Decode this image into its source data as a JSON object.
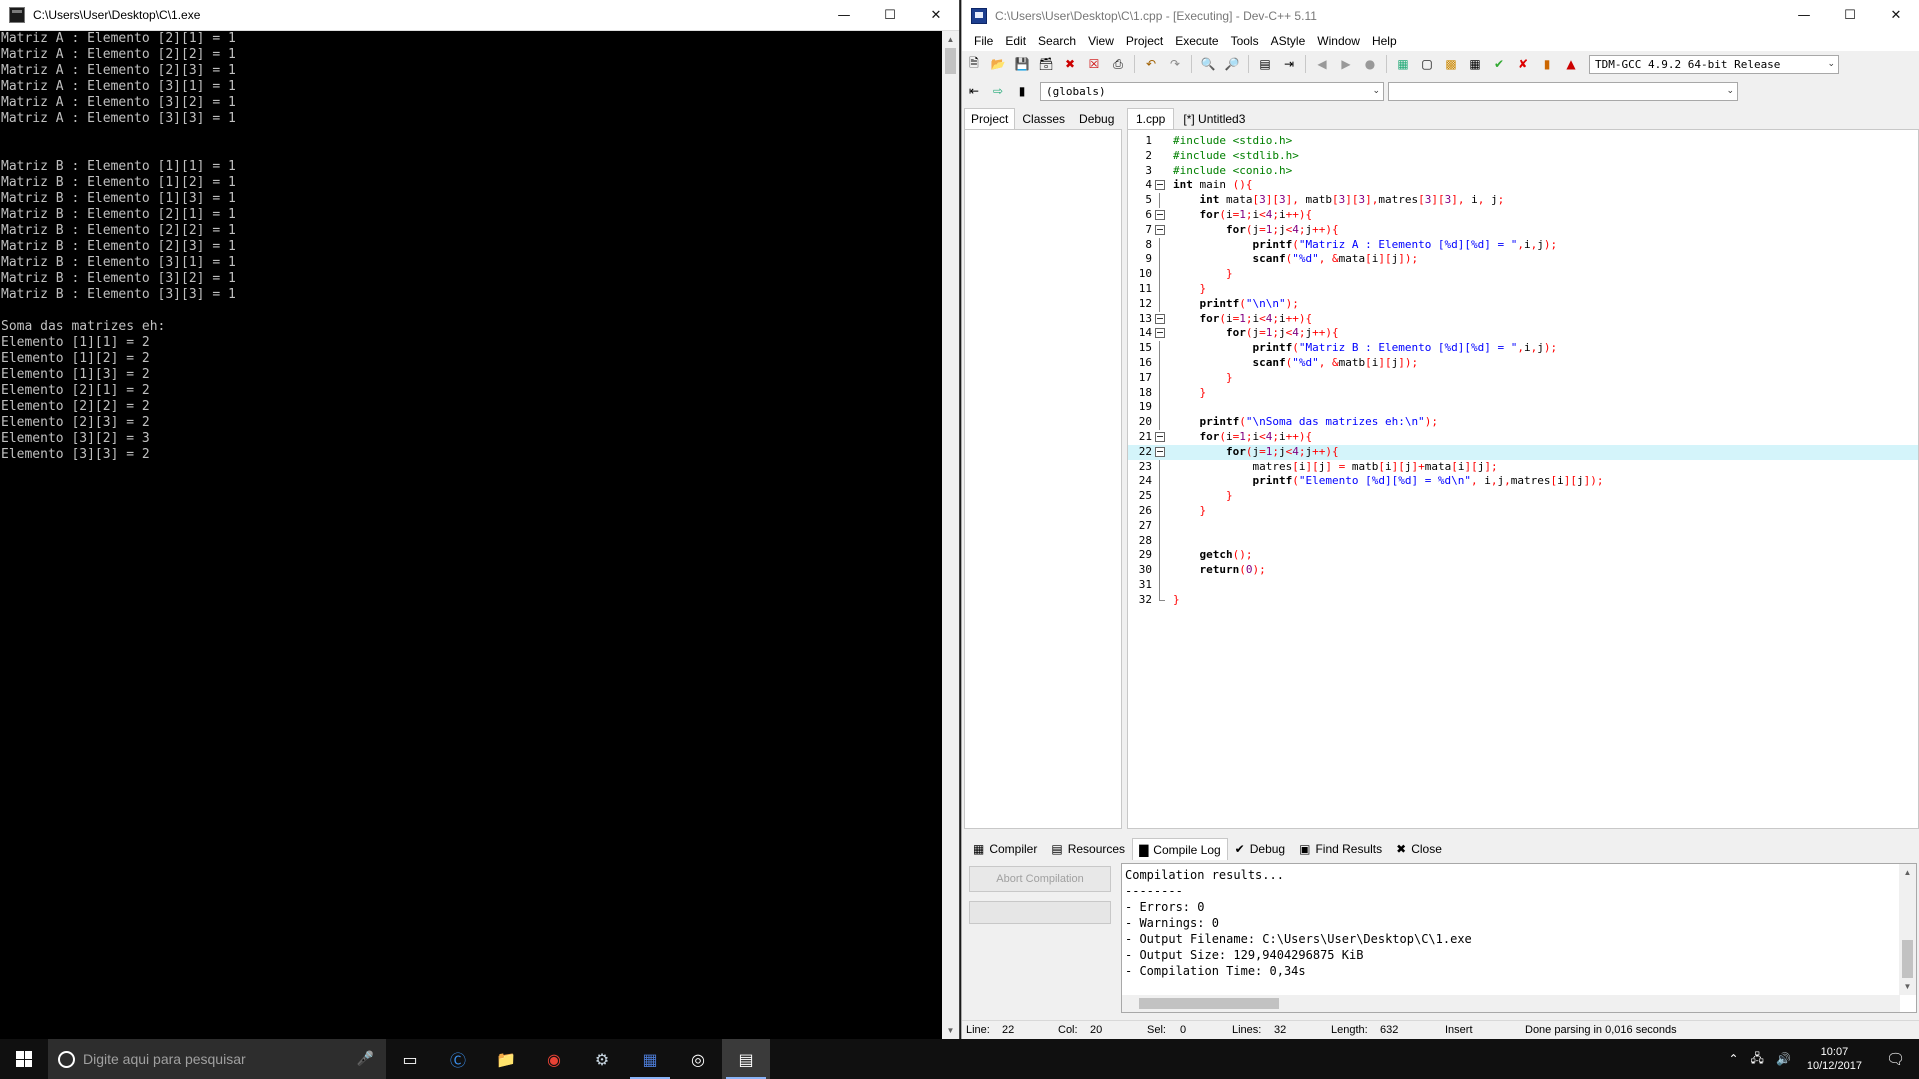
{
  "console_window": {
    "title": "C:\\Users\\User\\Desktop\\C\\1.exe",
    "output_lines": [
      "Matriz A : Elemento [2][1] = 1",
      "Matriz A : Elemento [2][2] = 1",
      "Matriz A : Elemento [2][3] = 1",
      "Matriz A : Elemento [3][1] = 1",
      "Matriz A : Elemento [3][2] = 1",
      "Matriz A : Elemento [3][3] = 1",
      "",
      "",
      "Matriz B : Elemento [1][1] = 1",
      "Matriz B : Elemento [1][2] = 1",
      "Matriz B : Elemento [1][3] = 1",
      "Matriz B : Elemento [2][1] = 1",
      "Matriz B : Elemento [2][2] = 1",
      "Matriz B : Elemento [2][3] = 1",
      "Matriz B : Elemento [3][1] = 1",
      "Matriz B : Elemento [3][2] = 1",
      "Matriz B : Elemento [3][3] = 1",
      "",
      "Soma das matrizes eh:",
      "Elemento [1][1] = 2",
      "Elemento [1][2] = 2",
      "Elemento [1][3] = 2",
      "Elemento [2][1] = 2",
      "Elemento [2][2] = 2",
      "Elemento [2][3] = 2",
      "Elemento [3][2] = 3",
      "Elemento [3][3] = 2"
    ]
  },
  "ide_window": {
    "title": "C:\\Users\\User\\Desktop\\C\\1.cpp - [Executing] - Dev-C++ 5.11",
    "menu": [
      "File",
      "Edit",
      "Search",
      "View",
      "Project",
      "Execute",
      "Tools",
      "AStyle",
      "Window",
      "Help"
    ],
    "compiler_select": "TDM-GCC 4.9.2 64-bit Release",
    "scope_select": "(globals)",
    "left_tabs": [
      "Project",
      "Classes",
      "Debug"
    ],
    "editor_tabs": [
      "1.cpp",
      "[*] Untitled3"
    ],
    "code_lines": [
      "#include <stdio.h>",
      "#include <stdlib.h>",
      "#include <conio.h>",
      "int main (){",
      "    int mata[3][3], matb[3][3],matres[3][3], i, j;",
      "    for(i=1;i<4;i++){",
      "        for(j=1;j<4;j++){",
      "            printf(\"Matriz A : Elemento [%d][%d] = \",i,j);",
      "            scanf(\"%d\", &mata[i][j]);",
      "        }",
      "    }",
      "    printf(\"\\n\\n\");",
      "    for(i=1;i<4;i++){",
      "        for(j=1;j<4;j++){",
      "            printf(\"Matriz B : Elemento [%d][%d] = \",i,j);",
      "            scanf(\"%d\", &matb[i][j]);",
      "        }",
      "    }",
      "",
      "    printf(\"\\nSoma das matrizes eh:\\n\");",
      "    for(i=1;i<4;i++){",
      "        for(j=1;j<4;j++){",
      "            matres[i][j] = matb[i][j]+mata[i][j];",
      "            printf(\"Elemento [%d][%d] = %d\\n\", i,j,matres[i][j]);",
      "        }",
      "    }",
      "",
      "",
      "    getch();",
      "    return(0);",
      "",
      "}"
    ],
    "bottom_tabs": [
      "Compiler",
      "Resources",
      "Compile Log",
      "Debug",
      "Find Results",
      "Close"
    ],
    "abort_button": "Abort Compilation",
    "compile_log": [
      "Compilation results...",
      "--------",
      "- Errors: 0",
      "- Warnings: 0",
      "- Output Filename: C:\\Users\\User\\Desktop\\C\\1.exe",
      "- Output Size: 129,9404296875 KiB",
      "- Compilation Time: 0,34s"
    ],
    "status": {
      "line_label": "Line:",
      "line": "22",
      "col_label": "Col:",
      "col": "20",
      "sel_label": "Sel:",
      "sel": "0",
      "lines_label": "Lines:",
      "lines": "32",
      "length_label": "Length:",
      "length": "632",
      "mode": "Insert",
      "message": "Done parsing in 0,016 seconds"
    }
  },
  "taskbar": {
    "search_placeholder": "Digite aqui para pesquisar",
    "clock_time": "10:07",
    "clock_date": "10/12/2017",
    "icons": [
      "task-view-icon",
      "edge-icon",
      "file-explorer-icon",
      "chrome-icon",
      "steam-icon",
      "devcpp-icon",
      "obs-icon",
      "console-icon"
    ]
  },
  "colors": {
    "keyword": "#000000",
    "preprocessor": "#008000",
    "string": "#0000ff",
    "symbol": "#ff0000",
    "number": "#800080",
    "active_line": "#d4f4fa"
  }
}
